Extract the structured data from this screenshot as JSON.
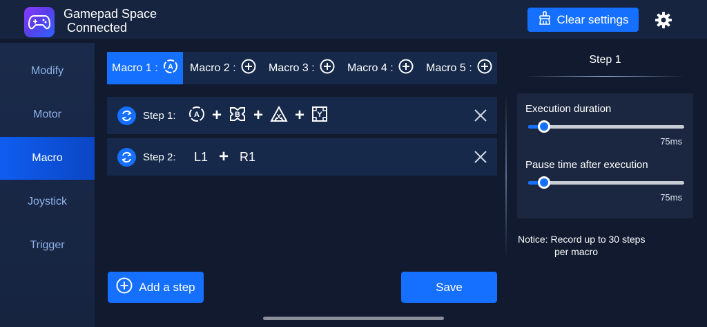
{
  "header": {
    "app_name": "Gamepad Space",
    "status": "Connected",
    "clear_button": "Clear settings",
    "icon_gamepad": "gamepad-icon",
    "icon_broom": "broom-icon",
    "icon_settings": "gear-icon"
  },
  "sidebar": {
    "items": [
      {
        "label": "Modify",
        "active": false
      },
      {
        "label": "Motor",
        "active": false
      },
      {
        "label": "Macro",
        "active": true
      },
      {
        "label": "Joystick",
        "active": false
      },
      {
        "label": "Trigger",
        "active": false
      }
    ]
  },
  "macro_tabs": [
    {
      "label": "Macro 1 :",
      "icon": "a-button-icon",
      "active": true
    },
    {
      "label": "Macro 2 :",
      "icon": "add-circle-icon",
      "active": false
    },
    {
      "label": "Macro 3 :",
      "icon": "add-circle-icon",
      "active": false
    },
    {
      "label": "Macro 4 :",
      "icon": "add-circle-icon",
      "active": false
    },
    {
      "label": "Macro 5 :",
      "icon": "add-circle-icon",
      "active": false
    }
  ],
  "steps": [
    {
      "label": "Step 1:",
      "buttons": [
        "A",
        "B",
        "X",
        "Y"
      ],
      "separator": "+"
    },
    {
      "label": "Step 2:",
      "buttons": [
        "L1",
        "R1"
      ],
      "separator": "+"
    }
  ],
  "actions": {
    "add_step": "Add a step",
    "save": "Save"
  },
  "right_panel": {
    "title": "Step 1",
    "execution_duration_label": "Execution duration",
    "execution_duration_value": "75ms",
    "execution_duration_level": 0.1,
    "pause_label": "Pause time after execution",
    "pause_value": "75ms",
    "pause_level": 0.1,
    "notice_prefix": "Notice:",
    "notice_text_1": "Record up to 30 steps",
    "notice_text_2": "per macro"
  },
  "colors": {
    "accent": "#1570ff",
    "background": "#111a2e",
    "panel": "#16294a",
    "sidebar_text": "#8fb2e8"
  }
}
